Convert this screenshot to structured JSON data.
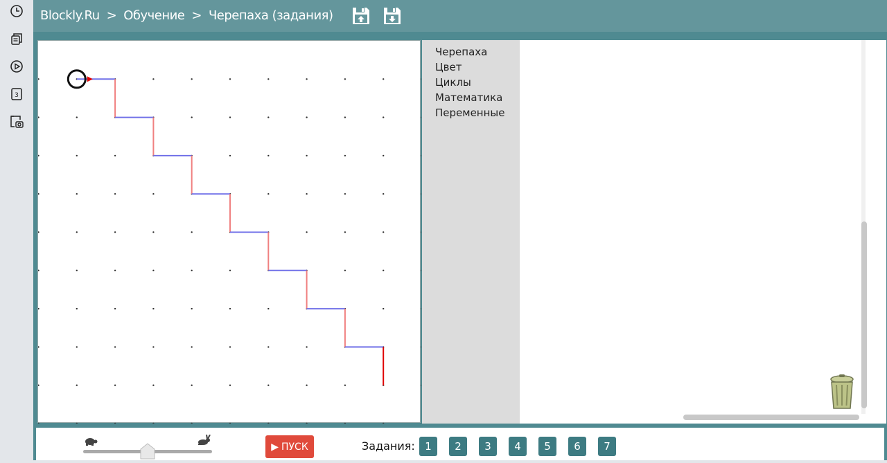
{
  "left_rail": {
    "icons": [
      "clock-icon",
      "copy-icon",
      "play-circle-icon",
      "number-3-icon",
      "screenshot-icon"
    ]
  },
  "topbar": {
    "breadcrumb": [
      "Blockly.Ru",
      "Обучение",
      "Черепаха (задания)"
    ],
    "separator": ">",
    "icons": [
      "save-upload-icon",
      "save-download-icon"
    ]
  },
  "turtle_canvas": {
    "grid_dots": "10 x 10",
    "path_colors": {
      "vertical": "#f08080",
      "horizontal": "#7070e8",
      "last_segment": "#e00000"
    },
    "turtle_marker": "circle-with-red-arrow"
  },
  "toolbox": {
    "categories": [
      "Черепаха",
      "Цвет",
      "Циклы",
      "Математика",
      "Переменные"
    ]
  },
  "bottombar": {
    "run_label": "ПУСК",
    "tasks_label": "Задания:",
    "tasks": [
      "1",
      "2",
      "3",
      "4",
      "5",
      "6",
      "7"
    ],
    "speed_value": 0.5
  },
  "colors": {
    "header": "#64969c",
    "frame": "#4f8a91",
    "task_button": "#3d7b82",
    "run_button": "#e04a3b"
  }
}
